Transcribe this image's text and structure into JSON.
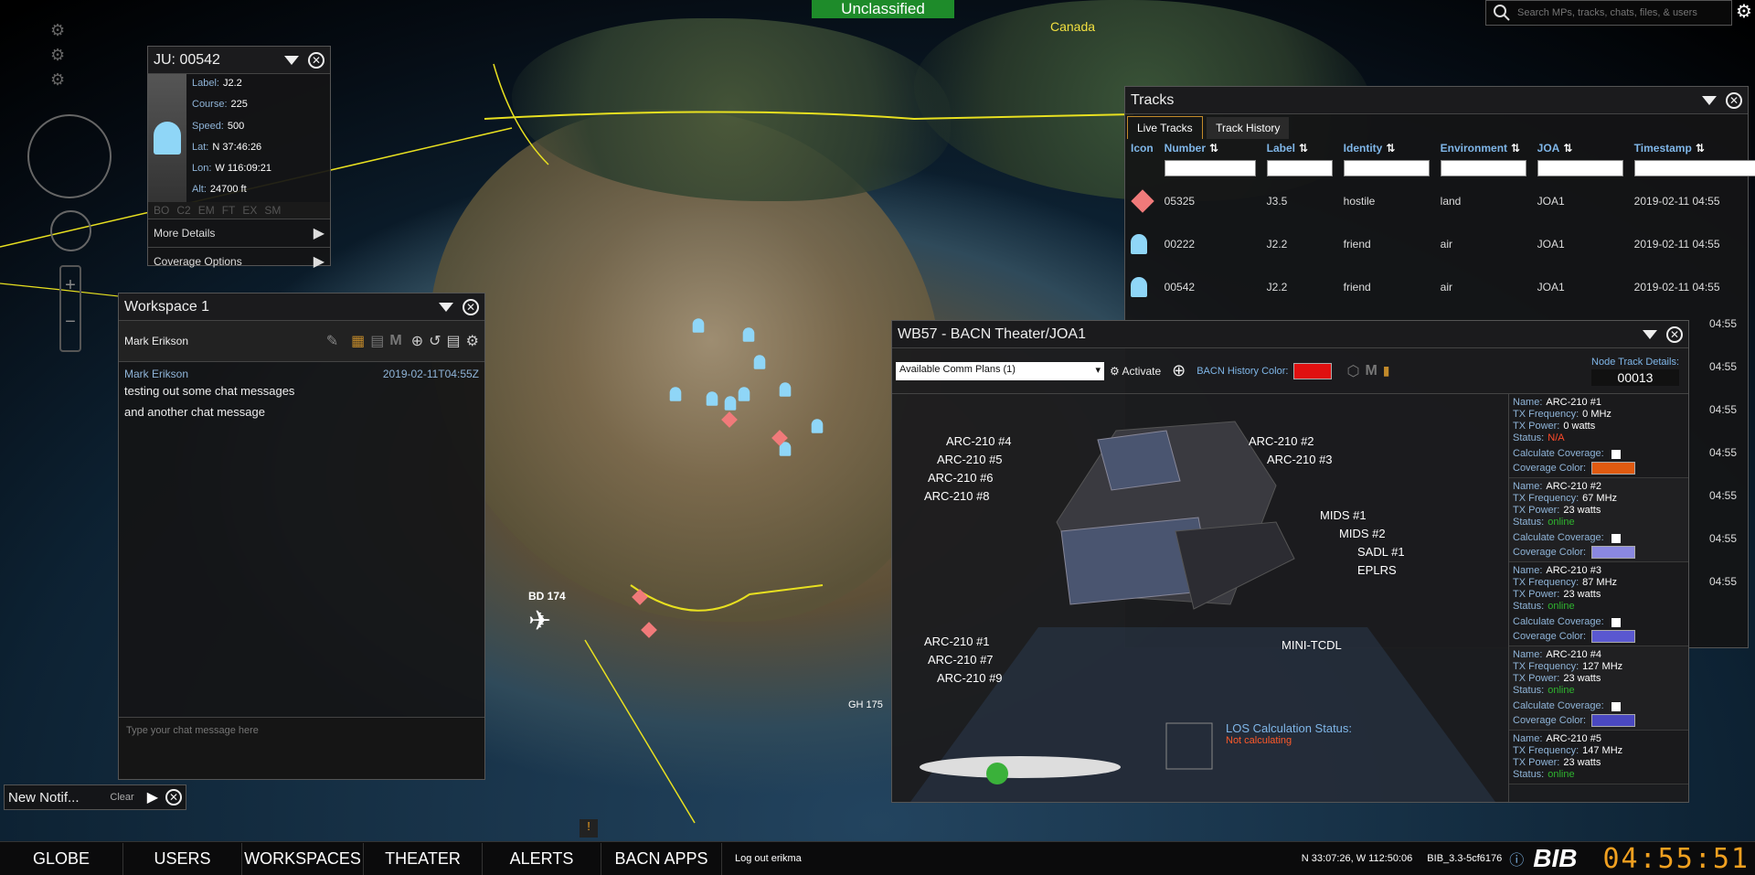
{
  "banner": "Unclassified",
  "map_labels": {
    "canada": "Canada",
    "bd174": "BD 174",
    "gh175": "GH 175"
  },
  "search": {
    "placeholder": "Search MPs, tracks, chats, files, & users"
  },
  "track_popup": {
    "title": "JU: 00542",
    "fields": [
      {
        "label": "Label:",
        "value": "J2.2"
      },
      {
        "label": "Course:",
        "value": "225"
      },
      {
        "label": "Speed:",
        "value": "500"
      },
      {
        "label": "Lat:",
        "value": "N 37:46:26"
      },
      {
        "label": "Lon:",
        "value": "W 116:09:21"
      },
      {
        "label": "Alt:",
        "value": "24700 ft"
      }
    ],
    "tabs": [
      "BO",
      "C2",
      "EM",
      "FT",
      "EX",
      "SM"
    ],
    "more_details": "More Details",
    "coverage_options": "Coverage Options"
  },
  "workspace": {
    "title": "Workspace 1",
    "user": "Mark Erikson",
    "message_author": "Mark Erikson",
    "message_time": "2019-02-11T04:55Z",
    "messages": [
      "testing out some chat messages",
      "and another chat message"
    ],
    "input_placeholder": "Type your chat message here"
  },
  "notifications": {
    "label": "New Notif...",
    "clear": "Clear"
  },
  "tracks": {
    "title": "Tracks",
    "tabs": [
      "Live Tracks",
      "Track History"
    ],
    "columns": [
      "Icon",
      "Number",
      "Label",
      "Identity",
      "Environment",
      "JOA",
      "Timestamp"
    ],
    "rows": [
      {
        "icon": "hostile-diamond-icon",
        "number": "05325",
        "label": "J3.5",
        "identity": "hostile",
        "environment": "land",
        "joa": "JOA1",
        "timestamp": "2019-02-11 04:55"
      },
      {
        "icon": "friend-air-icon",
        "number": "00222",
        "label": "J2.2",
        "identity": "friend",
        "environment": "air",
        "joa": "JOA1",
        "timestamp": "2019-02-11 04:55"
      },
      {
        "icon": "friend-air-icon",
        "number": "00542",
        "label": "J2.2",
        "identity": "friend",
        "environment": "air",
        "joa": "JOA1",
        "timestamp": "2019-02-11 04:55"
      }
    ],
    "hidden_timestamps": [
      "04:55",
      "04:55",
      "04:55",
      "04:55",
      "04:55",
      "04:55",
      "04:55"
    ]
  },
  "wb57": {
    "title": "WB57 - BACN Theater/JOA1",
    "comm_plans": "Available Comm Plans (1)",
    "activate": "Activate",
    "history_color_label": "BACN History Color:",
    "history_color": "#e01010",
    "node_track_label": "Node Track Details:",
    "node_track_value": "00013",
    "nodes_left": [
      "ARC-210 #4",
      "ARC-210 #5",
      "ARC-210 #6",
      "ARC-210 #8"
    ],
    "nodes_right": [
      "ARC-210 #2",
      "ARC-210 #3",
      "MIDS #1",
      "MIDS #2",
      "SADL #1",
      "EPLRS",
      "MINI-TCDL"
    ],
    "nodes_bottom": [
      "ARC-210 #1",
      "ARC-210 #7",
      "ARC-210 #9"
    ],
    "los_label": "LOS Calculation Status:",
    "los_status": "Not calculating",
    "details": [
      {
        "name": "ARC-210 #1",
        "freq": "0 MHz",
        "power": "0 watts",
        "status": "N/A",
        "status_color": "#ff4a2a",
        "cov_color": "#e05a10"
      },
      {
        "name": "ARC-210 #2",
        "freq": "67 MHz",
        "power": "23 watts",
        "status": "online",
        "status_color": "#2fb32f",
        "cov_color": "#8a88e0"
      },
      {
        "name": "ARC-210 #3",
        "freq": "87 MHz",
        "power": "23 watts",
        "status": "online",
        "status_color": "#2fb32f",
        "cov_color": "#5a58d0"
      },
      {
        "name": "ARC-210 #4",
        "freq": "127 MHz",
        "power": "23 watts",
        "status": "online",
        "status_color": "#2fb32f",
        "cov_color": "#4a48c0"
      },
      {
        "name": "ARC-210 #5",
        "freq": "147 MHz",
        "power": "23 watts",
        "status": "online",
        "status_color": "#2fb32f",
        "cov_color": ""
      }
    ],
    "detail_labels": {
      "name": "Name:",
      "freq": "TX Frequency:",
      "power": "TX Power:",
      "status": "Status:",
      "calc": "Calculate Coverage:",
      "cov": "Coverage Color:"
    }
  },
  "bottom_nav": {
    "items": [
      "GLOBE",
      "USERS",
      "WORKSPACES",
      "THEATER",
      "ALERTS",
      "BACN APPS"
    ],
    "logout": "Log out erikma",
    "coords": "N 33:07:26, W 112:50:06",
    "version": "BIB_3.3-5cf6176",
    "logo": "BIB",
    "clock": "04:55:51"
  }
}
